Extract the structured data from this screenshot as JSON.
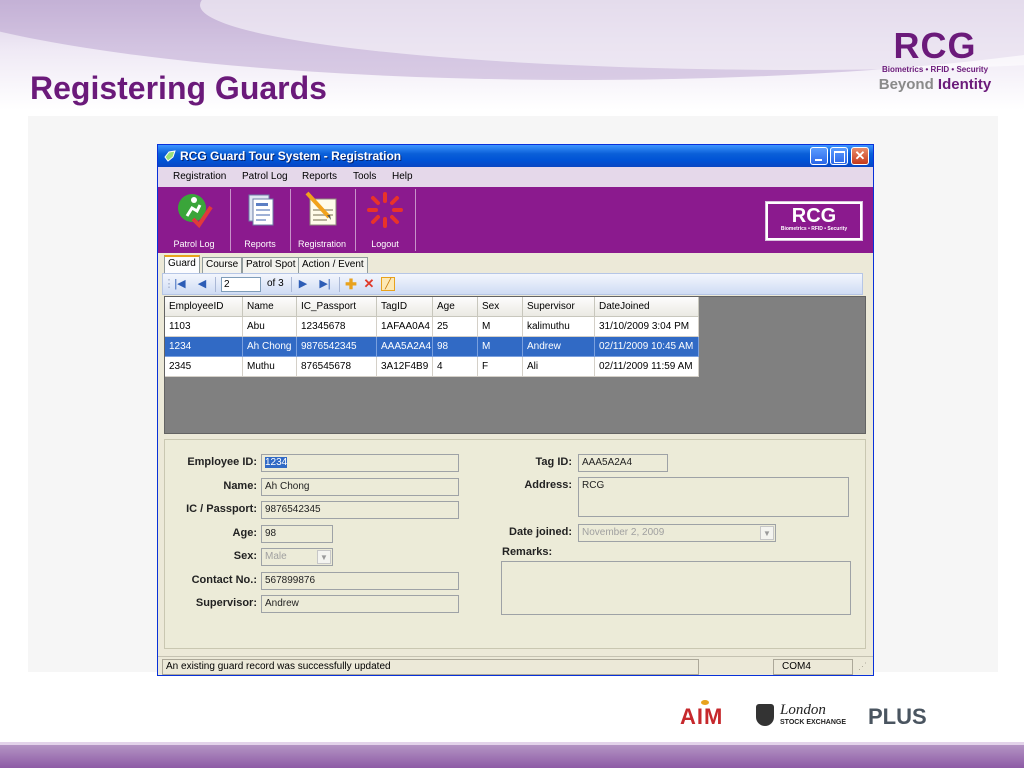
{
  "slide": {
    "title": "Registering Guards",
    "brand": {
      "name": "RCG",
      "tagline": "Biometrics • RFID • Security",
      "slogan_prefix": "Beyond",
      "slogan_emph": "Identity"
    },
    "partners": {
      "aim": "AIM",
      "lse_line1": "London",
      "lse_line2": "STOCK EXCHANGE",
      "plus": "PLUS"
    }
  },
  "window": {
    "title": "RCG Guard Tour System - Registration",
    "menu": [
      "Registration",
      "Patrol Log",
      "Reports",
      "Tools",
      "Help"
    ],
    "toolbar": [
      {
        "label": "Patrol Log",
        "icon": "runner-check-icon"
      },
      {
        "label": "Reports",
        "icon": "reports-icon"
      },
      {
        "label": "Registration",
        "icon": "registration-icon"
      },
      {
        "label": "Logout",
        "icon": "logout-icon"
      }
    ],
    "toolbar_logo": {
      "name": "RCG",
      "tagline": "Biometrics • RFID • Security"
    },
    "tabs": [
      "Guard",
      "Course",
      "Patrol Spot",
      "Action / Event"
    ],
    "active_tab": "Guard",
    "navigator": {
      "position": "2",
      "of_label": "of 3"
    },
    "grid": {
      "columns": [
        "EmployeeID",
        "Name",
        "IC_Passport",
        "TagID",
        "Age",
        "Sex",
        "Supervisor",
        "DateJoined"
      ],
      "rows": [
        [
          "1103",
          "Abu",
          "12345678",
          "1AFAA0A4",
          "25",
          "M",
          "kalimuthu",
          "31/10/2009 3:04 PM"
        ],
        [
          "1234",
          "Ah Chong",
          "9876542345",
          "AAA5A2A4",
          "98",
          "M",
          "Andrew",
          "02/11/2009 10:45 AM"
        ],
        [
          "2345",
          "Muthu",
          "876545678",
          "3A12F4B9",
          "4",
          "F",
          "Ali",
          "02/11/2009 11:59 AM"
        ]
      ],
      "selected_row": 1
    },
    "form": {
      "employee_id_label": "Employee ID:",
      "employee_id": "1234",
      "name_label": "Name:",
      "name": "Ah Chong",
      "passport_label": "IC / Passport:",
      "passport": "9876542345",
      "age_label": "Age:",
      "age": "98",
      "sex_label": "Sex:",
      "sex": "Male",
      "contact_label": "Contact No.:",
      "contact": "567899876",
      "supervisor_label": "Supervisor:",
      "supervisor": "Andrew",
      "tag_label": "Tag ID:",
      "tag": "AAA5A2A4",
      "address_label": "Address:",
      "address": "RCG",
      "date_label": "Date joined:",
      "date": "November   2, 2009",
      "remarks_label": "Remarks:",
      "remarks": ""
    },
    "status": {
      "message": "An existing guard record was successfully updated",
      "port": "COM4"
    }
  }
}
